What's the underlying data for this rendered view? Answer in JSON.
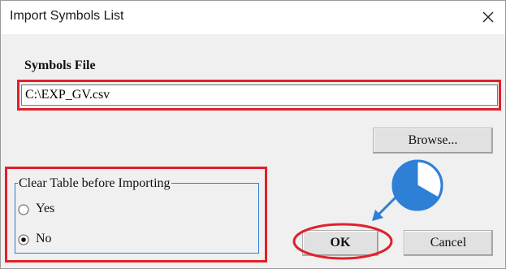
{
  "dialog": {
    "title": "Import Symbols List",
    "close_icon": "close-icon"
  },
  "symbols_file": {
    "label": "Symbols File",
    "path_value": "C:\\EXP_GV.csv",
    "browse_label": "Browse..."
  },
  "clear_table_group": {
    "legend": "Clear Table before Importing",
    "options": [
      {
        "label": "Yes",
        "selected": false
      },
      {
        "label": "No",
        "selected": true
      }
    ]
  },
  "buttons": {
    "ok_label": "OK",
    "cancel_label": "Cancel"
  },
  "annotations": {
    "highlight_color": "#e0212a",
    "pointer_color": "#2e7fd6",
    "pie_icon": "three-quarter-pie-icon",
    "arrow_icon": "arrow-icon"
  }
}
